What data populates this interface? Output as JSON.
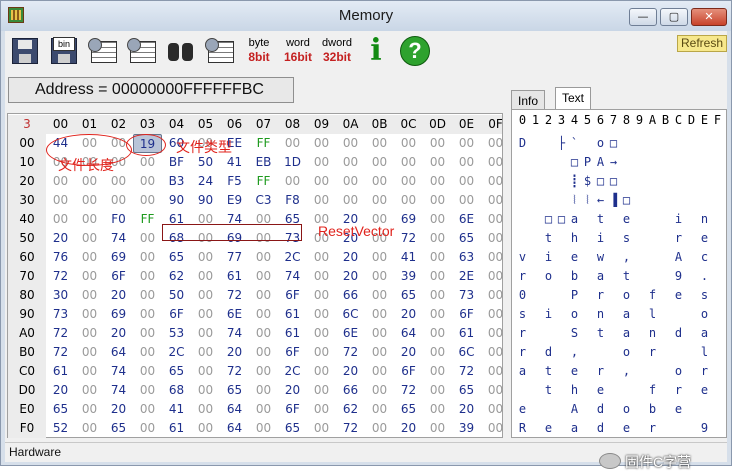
{
  "window": {
    "title": "Memory",
    "min": "—",
    "max": "▢",
    "close": "✕"
  },
  "toolbar": {
    "bin_label": "bin",
    "byte_l1": "byte",
    "byte_l2": "8bit",
    "word_l1": "word",
    "word_l2": "16bit",
    "dword_l1": "dword",
    "dword_l2": "32bit",
    "info_label": "i",
    "help_label": "?",
    "refresh_label": "Refresh",
    "icons": [
      "save-disk-icon",
      "load-bin-icon",
      "memory-grid-icon",
      "memory-grid-alt-icon",
      "binoculars-icon",
      "table-view-icon",
      "byte-8bit-icon",
      "word-16bit-icon",
      "dword-32bit-icon",
      "info-icon",
      "help-icon"
    ]
  },
  "address": {
    "text": "Address = 00000000FFFFFFBC"
  },
  "hex": {
    "corner": "3",
    "columns": [
      "00",
      "01",
      "02",
      "03",
      "04",
      "05",
      "06",
      "07",
      "08",
      "09",
      "0A",
      "0B",
      "0C",
      "0D",
      "0E",
      "0F"
    ],
    "rows": [
      {
        "addr": "00",
        "cells": [
          "44",
          "00",
          "00",
          "19",
          "60",
          "00",
          "EE",
          "FF",
          "00",
          "00",
          "00",
          "00",
          "00",
          "00",
          "00",
          "00"
        ]
      },
      {
        "addr": "10",
        "cells": [
          "00",
          "00",
          "00",
          "00",
          "BF",
          "50",
          "41",
          "EB",
          "1D",
          "00",
          "00",
          "00",
          "00",
          "00",
          "00",
          "00"
        ]
      },
      {
        "addr": "20",
        "cells": [
          "00",
          "00",
          "00",
          "00",
          "B3",
          "24",
          "F5",
          "FF",
          "00",
          "00",
          "00",
          "00",
          "00",
          "00",
          "00",
          "00"
        ]
      },
      {
        "addr": "30",
        "cells": [
          "00",
          "00",
          "00",
          "00",
          "90",
          "90",
          "E9",
          "C3",
          "F8",
          "00",
          "00",
          "00",
          "00",
          "00",
          "00",
          "00"
        ]
      },
      {
        "addr": "40",
        "cells": [
          "00",
          "00",
          "F0",
          "FF",
          "61",
          "00",
          "74",
          "00",
          "65",
          "00",
          "20",
          "00",
          "69",
          "00",
          "6E",
          "00"
        ]
      },
      {
        "addr": "50",
        "cells": [
          "20",
          "00",
          "74",
          "00",
          "68",
          "00",
          "69",
          "00",
          "73",
          "00",
          "20",
          "00",
          "72",
          "00",
          "65",
          "00"
        ]
      },
      {
        "addr": "60",
        "cells": [
          "76",
          "00",
          "69",
          "00",
          "65",
          "00",
          "77",
          "00",
          "2C",
          "00",
          "20",
          "00",
          "41",
          "00",
          "63",
          "00"
        ]
      },
      {
        "addr": "70",
        "cells": [
          "72",
          "00",
          "6F",
          "00",
          "62",
          "00",
          "61",
          "00",
          "74",
          "00",
          "20",
          "00",
          "39",
          "00",
          "2E",
          "00"
        ]
      },
      {
        "addr": "80",
        "cells": [
          "30",
          "00",
          "20",
          "00",
          "50",
          "00",
          "72",
          "00",
          "6F",
          "00",
          "66",
          "00",
          "65",
          "00",
          "73",
          "00"
        ]
      },
      {
        "addr": "90",
        "cells": [
          "73",
          "00",
          "69",
          "00",
          "6F",
          "00",
          "6E",
          "00",
          "61",
          "00",
          "6C",
          "00",
          "20",
          "00",
          "6F",
          "00"
        ]
      },
      {
        "addr": "A0",
        "cells": [
          "72",
          "00",
          "20",
          "00",
          "53",
          "00",
          "74",
          "00",
          "61",
          "00",
          "6E",
          "00",
          "64",
          "00",
          "61",
          "00"
        ]
      },
      {
        "addr": "B0",
        "cells": [
          "72",
          "00",
          "64",
          "00",
          "2C",
          "00",
          "20",
          "00",
          "6F",
          "00",
          "72",
          "00",
          "20",
          "00",
          "6C",
          "00"
        ]
      },
      {
        "addr": "C0",
        "cells": [
          "61",
          "00",
          "74",
          "00",
          "65",
          "00",
          "72",
          "00",
          "2C",
          "00",
          "20",
          "00",
          "6F",
          "00",
          "72",
          "00"
        ]
      },
      {
        "addr": "D0",
        "cells": [
          "20",
          "00",
          "74",
          "00",
          "68",
          "00",
          "65",
          "00",
          "20",
          "00",
          "66",
          "00",
          "72",
          "00",
          "65",
          "00"
        ]
      },
      {
        "addr": "E0",
        "cells": [
          "65",
          "00",
          "20",
          "00",
          "41",
          "00",
          "64",
          "00",
          "6F",
          "00",
          "62",
          "00",
          "65",
          "00",
          "20",
          "00"
        ]
      },
      {
        "addr": "F0",
        "cells": [
          "52",
          "00",
          "65",
          "00",
          "61",
          "00",
          "64",
          "00",
          "65",
          "00",
          "72",
          "00",
          "20",
          "00",
          "39",
          "00"
        ]
      }
    ],
    "selected": {
      "row": 0,
      "col": 3
    }
  },
  "annotations": {
    "file_length": "文件长度",
    "file_type": "文件类型",
    "reset_vector": "ResetVector"
  },
  "tabs": {
    "info": "Info",
    "text": "Text"
  },
  "text_view": {
    "columns": [
      "0",
      "1",
      "2",
      "3",
      "4",
      "5",
      "6",
      "7",
      "8",
      "9",
      "A",
      "B",
      "C",
      "D",
      "E",
      "F"
    ],
    "rows": [
      [
        "D",
        " ",
        " ",
        "├",
        "`",
        " ",
        "o",
        "□",
        " ",
        " ",
        " ",
        " ",
        " ",
        " ",
        " ",
        " "
      ],
      [
        " ",
        " ",
        " ",
        " ",
        "□",
        "P",
        "A",
        "→",
        " ",
        " ",
        " ",
        " ",
        " ",
        " ",
        " ",
        " "
      ],
      [
        " ",
        " ",
        " ",
        " ",
        "┋",
        "$",
        "□",
        "□",
        " ",
        " ",
        " ",
        " ",
        " ",
        " ",
        " ",
        " "
      ],
      [
        " ",
        " ",
        " ",
        " ",
        "⦚",
        "⦚",
        "←",
        "▐",
        "□",
        " ",
        " ",
        " ",
        " ",
        " ",
        " ",
        " "
      ],
      [
        " ",
        " ",
        "□",
        "□",
        "a",
        " ",
        "t",
        " ",
        "e",
        " ",
        " ",
        " ",
        "i",
        " ",
        "n",
        " "
      ],
      [
        " ",
        " ",
        "t",
        " ",
        "h",
        " ",
        "i",
        " ",
        "s",
        " ",
        " ",
        " ",
        "r",
        " ",
        "e",
        " "
      ],
      [
        "v",
        " ",
        "i",
        " ",
        "e",
        " ",
        "w",
        " ",
        ",",
        " ",
        " ",
        " ",
        "A",
        " ",
        "c",
        " "
      ],
      [
        "r",
        " ",
        "o",
        " ",
        "b",
        " ",
        "a",
        " ",
        "t",
        " ",
        " ",
        " ",
        "9",
        " ",
        ".",
        " "
      ],
      [
        "0",
        " ",
        " ",
        " ",
        "P",
        " ",
        "r",
        " ",
        "o",
        " ",
        "f",
        " ",
        "e",
        " ",
        "s",
        " "
      ],
      [
        "s",
        " ",
        "i",
        " ",
        "o",
        " ",
        "n",
        " ",
        "a",
        " ",
        "l",
        " ",
        " ",
        " ",
        "o",
        " "
      ],
      [
        "r",
        " ",
        " ",
        " ",
        "S",
        " ",
        "t",
        " ",
        "a",
        " ",
        "n",
        " ",
        "d",
        " ",
        "a",
        " "
      ],
      [
        "r",
        " ",
        "d",
        " ",
        ",",
        " ",
        " ",
        " ",
        "o",
        " ",
        "r",
        " ",
        " ",
        " ",
        "l",
        " "
      ],
      [
        "a",
        " ",
        "t",
        " ",
        "e",
        " ",
        "r",
        " ",
        ",",
        " ",
        " ",
        " ",
        "o",
        " ",
        "r",
        " "
      ],
      [
        " ",
        " ",
        "t",
        " ",
        "h",
        " ",
        "e",
        " ",
        " ",
        " ",
        "f",
        " ",
        "r",
        " ",
        "e",
        " "
      ],
      [
        "e",
        " ",
        " ",
        " ",
        "A",
        " ",
        "d",
        " ",
        "o",
        " ",
        "b",
        " ",
        "e",
        " ",
        " ",
        " "
      ],
      [
        "R",
        " ",
        "e",
        " ",
        "a",
        " ",
        "d",
        " ",
        "e",
        " ",
        "r",
        " ",
        " ",
        " ",
        "9",
        " "
      ]
    ]
  },
  "status": {
    "text": "Hardware"
  },
  "watermark": {
    "text": "固件C字营"
  }
}
